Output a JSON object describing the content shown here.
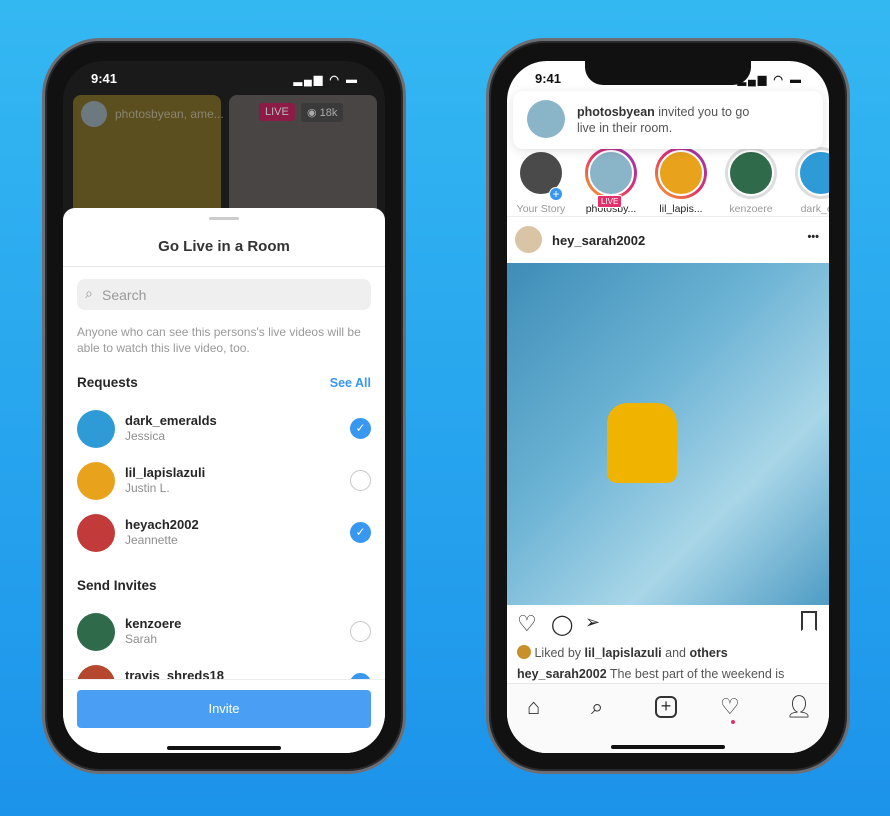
{
  "left": {
    "status_time": "9:41",
    "live_header": {
      "names": "photosbyean, ame...",
      "live_badge": "LIVE",
      "viewers": "18k"
    },
    "sheet": {
      "title": "Go Live in a Room",
      "search_placeholder": "Search",
      "notice": "Anyone who can see this persons's live videos will be able to watch this live video, too.",
      "requests_heading": "Requests",
      "see_all": "See All",
      "requests": [
        {
          "username": "dark_emeralds",
          "name": "Jessica",
          "checked": true,
          "color": "#2e9bd6"
        },
        {
          "username": "lil_lapislazuli",
          "name": "Justin L.",
          "checked": false,
          "color": "#e8a21c"
        },
        {
          "username": "heyach2002",
          "name": "Jeannette",
          "checked": true,
          "color": "#c23a3a"
        }
      ],
      "invites_heading": "Send Invites",
      "invites": [
        {
          "username": "kenzoere",
          "name": "Sarah",
          "checked": false,
          "color": "#2f6b4a"
        },
        {
          "username": "travis_shreds18",
          "name": "",
          "checked": true,
          "color": "#b5472e"
        }
      ],
      "invite_button": "Invite"
    }
  },
  "right": {
    "status_time": "9:41",
    "notification": {
      "username": "photosbyean",
      "message": "invited you to go live in their room."
    },
    "stories": [
      {
        "label": "Your Story",
        "ring": false,
        "add": true,
        "color": "#4a4a4a"
      },
      {
        "label": "photosby...",
        "ring": true,
        "live": "LIVE",
        "color": "#8ab4c8"
      },
      {
        "label": "lil_lapis...",
        "ring": true,
        "color": "#e8a21c"
      },
      {
        "label": "kenzoere",
        "ring": false,
        "color": "#2f6b4a"
      },
      {
        "label": "dark_e...",
        "ring": false,
        "color": "#2e9bd6"
      }
    ],
    "post": {
      "username": "hey_sarah2002",
      "more": "•••",
      "liked_prefix": "Liked by",
      "liked_user": "lil_lapislazuli",
      "liked_and": "and",
      "liked_others": "others",
      "caption_user": "hey_sarah2002",
      "caption": "The best part of the weekend is"
    },
    "nav": [
      "home-icon",
      "search-icon",
      "add-icon",
      "heart-icon",
      "profile-icon"
    ]
  },
  "colors": {
    "accent": "#3897f0",
    "live": "#e1306c",
    "background": "#2aa8ef"
  }
}
